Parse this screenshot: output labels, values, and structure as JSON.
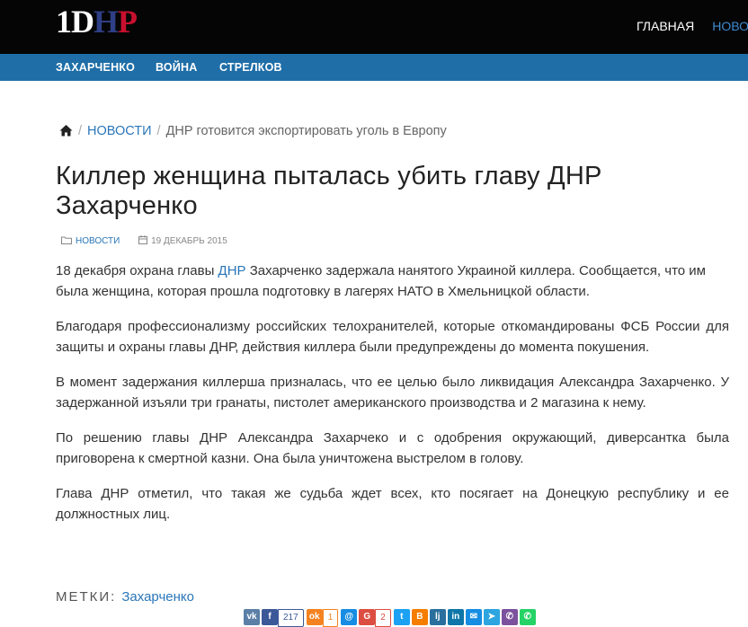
{
  "header": {
    "logo": {
      "part1": "1D",
      "part2": "H",
      "part3": "P"
    },
    "nav": [
      {
        "label": "ГЛАВНАЯ",
        "active": true
      },
      {
        "label": "НОВОС",
        "active": false
      }
    ]
  },
  "subnav": [
    "ЗАХАРЧЕНКО",
    "ВОЙНА",
    "СТРЕЛКОВ"
  ],
  "breadcrumb": {
    "home_icon": "home-icon",
    "section": "НОВОСТИ",
    "current": "ДНР готовится экспортировать уголь в Европу"
  },
  "article": {
    "title": "Киллер женщина пыталась убить главу ДНР Захарченко",
    "category": "НОВОСТИ",
    "date": "19 ДЕКАБРЬ 2015",
    "p1_before": "18 декабря охрана главы ",
    "p1_link": "ДНР",
    "p1_after": " Захарченко задержала нанятого Украиной киллера. Сообщается, что им была женщина, которая прошла подготовку в лагерях НАТО в Хмельницкой области.",
    "p2": "Благодаря профессионализму российских телохранителей, которые откомандированы ФСБ России для защиты и охраны главы ДНР, действия киллера были предупреждены до момента покушения.",
    "p3": "В момент задержания киллерша призналась, что ее целью было ликвидация Александра Захарченко. У задержанной изъяли три гранаты, пистолет американского производства и 2 магазина к нему.",
    "p4": "По решению главы ДНР Александра Захарчеко и с одобрения окружающий, диверсантка была приговорена к смертной казни. Она была уничтожена выстрелом в голову.",
    "p5": "Глава ДНР отметил, что такая же судьба ждет всех, кто посягает на Донецкую республику и ее должностных лиц."
  },
  "tags": {
    "label": "МЕТКИ:",
    "items": [
      "Захарченко"
    ]
  },
  "share": {
    "vk": {
      "label": "vk",
      "color": "#5b7fa6"
    },
    "fb": {
      "label": "f",
      "count": "217",
      "color": "#3b5998"
    },
    "ok": {
      "label": "ok",
      "count": "1",
      "color": "#f58220"
    },
    "mm": {
      "label": "@",
      "color": "#168de2"
    },
    "gp": {
      "label": "G",
      "count": "2",
      "color": "#dc4e41"
    },
    "tw": {
      "label": "t",
      "color": "#1da1f2"
    },
    "blogger": {
      "label": "B",
      "color": "#f57d00"
    },
    "lj": {
      "label": "lj",
      "color": "#2a6f9e"
    },
    "li": {
      "label": "in",
      "color": "#0e76a8"
    },
    "email": {
      "label": "✉",
      "color": "#168de2"
    },
    "tg": {
      "label": "➤",
      "color": "#2ca5e0"
    },
    "viber": {
      "label": "✆",
      "color": "#7b519d"
    },
    "wa": {
      "label": "✆",
      "color": "#25d366"
    }
  }
}
